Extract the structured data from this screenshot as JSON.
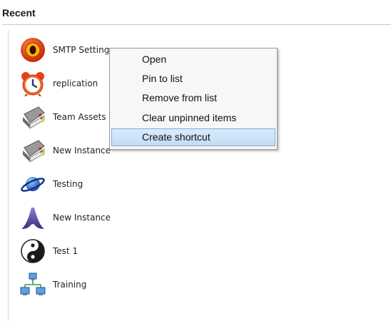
{
  "section": {
    "title": "Recent"
  },
  "recent": {
    "items": [
      {
        "label": "SMTP Setting",
        "icon": "target-disc-icon"
      },
      {
        "label": "replication",
        "icon": "alarm-clock-icon"
      },
      {
        "label": "Team Assets",
        "icon": "address-book-icon"
      },
      {
        "label": "New Instance",
        "icon": "address-book-icon"
      },
      {
        "label": "Testing",
        "icon": "planet-icon"
      },
      {
        "label": "New Instance",
        "icon": "arch-logo-icon"
      },
      {
        "label": "Test 1",
        "icon": "yin-yang-icon"
      },
      {
        "label": "Training",
        "icon": "network-icon"
      }
    ]
  },
  "context_menu": {
    "items": [
      {
        "label": "Open"
      },
      {
        "label": "Pin to list"
      },
      {
        "label": "Remove from list"
      },
      {
        "label": "Clear unpinned items"
      },
      {
        "label": "Create shortcut",
        "highlighted": true
      }
    ]
  },
  "colors": {
    "menu_background": "#f7f7f7",
    "menu_border": "#979797",
    "highlight_border": "#84acdd",
    "highlight_fill": "#c2dcf4"
  }
}
